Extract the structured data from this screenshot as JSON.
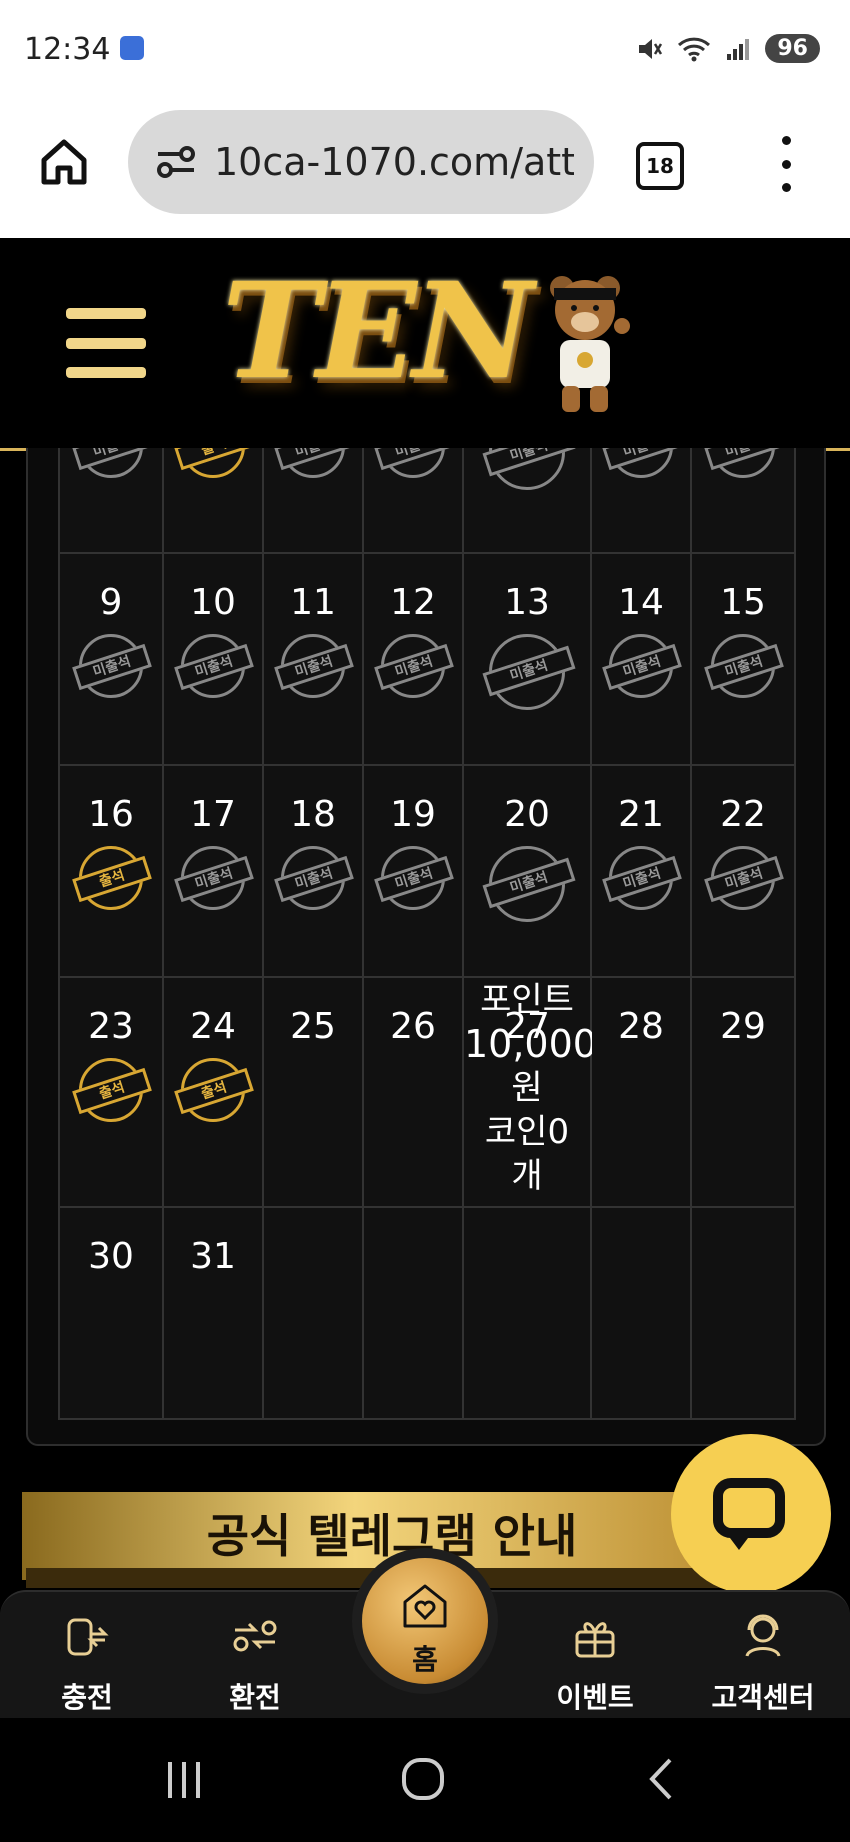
{
  "status_bar": {
    "time": "12:34",
    "battery": "96"
  },
  "browser": {
    "url": "10ca-1070.com/att",
    "tab_count": "18"
  },
  "site": {
    "logo_text": "TEN"
  },
  "calendar": {
    "partial_row_stamps": [
      "absent",
      "present",
      "absent",
      "absent",
      "absent",
      "absent",
      "absent"
    ],
    "stamp_labels": {
      "absent": "미출석",
      "present": "출석"
    },
    "weeks": [
      [
        {
          "day": "9",
          "stamp": "absent"
        },
        {
          "day": "10",
          "stamp": "absent"
        },
        {
          "day": "11",
          "stamp": "absent"
        },
        {
          "day": "12",
          "stamp": "absent"
        },
        {
          "day": "13",
          "stamp": "absent"
        },
        {
          "day": "14",
          "stamp": "absent"
        },
        {
          "day": "15",
          "stamp": "absent"
        }
      ],
      [
        {
          "day": "16",
          "stamp": "present"
        },
        {
          "day": "17",
          "stamp": "absent"
        },
        {
          "day": "18",
          "stamp": "absent"
        },
        {
          "day": "19",
          "stamp": "absent"
        },
        {
          "day": "20",
          "stamp": "absent"
        },
        {
          "day": "21",
          "stamp": "absent"
        },
        {
          "day": "22",
          "stamp": "absent"
        }
      ],
      [
        {
          "day": "23",
          "stamp": "present"
        },
        {
          "day": "24",
          "stamp": "present"
        },
        {
          "day": "25",
          "stamp": ""
        },
        {
          "day": "26",
          "stamp": ""
        },
        {
          "day": "27",
          "stamp": ""
        },
        {
          "day": "28",
          "stamp": ""
        },
        {
          "day": "29",
          "stamp": ""
        }
      ],
      [
        {
          "day": "30",
          "stamp": ""
        },
        {
          "day": "31",
          "stamp": ""
        },
        {
          "day": "",
          "stamp": ""
        },
        {
          "day": "",
          "stamp": ""
        },
        {
          "day": "",
          "stamp": ""
        },
        {
          "day": "",
          "stamp": ""
        },
        {
          "day": "",
          "stamp": ""
        }
      ]
    ],
    "reward_popup": {
      "lines": [
        "포인트",
        "10,000",
        "원",
        "코인0",
        "개"
      ]
    }
  },
  "banner": {
    "text": "공식 텔레그램 안내"
  },
  "bottom_nav": {
    "items": [
      {
        "label": "충전",
        "icon": "deposit-icon"
      },
      {
        "label": "환전",
        "icon": "withdraw-icon"
      },
      {
        "label": "홈",
        "icon": "home-heart-icon"
      },
      {
        "label": "이벤트",
        "icon": "gift-icon"
      },
      {
        "label": "고객센터",
        "icon": "support-icon"
      }
    ]
  },
  "colors": {
    "gold": "#d8a733",
    "header_line": "#d9b45a",
    "chat_button": "#f6cf52"
  }
}
